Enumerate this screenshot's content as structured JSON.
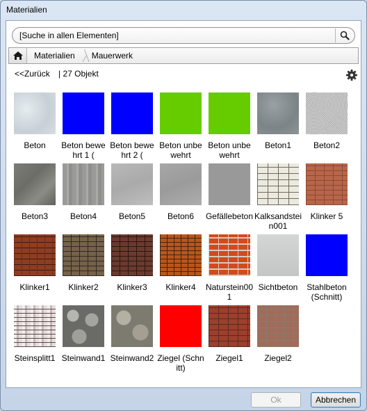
{
  "window": {
    "title": "Materialien"
  },
  "search": {
    "value": "[Suche in allen Elementen]",
    "icon": "search-icon"
  },
  "breadcrumb": {
    "home_icon": "home-icon",
    "items": [
      "Materialien",
      "Mauerwerk"
    ]
  },
  "nav": {
    "back_label": "<<Zurück",
    "count_label": "| 27 Objekt",
    "settings_icon": "gear-icon"
  },
  "materials": [
    {
      "name": "Beton",
      "texture": "concrete-light"
    },
    {
      "name": "Beton bewehrt 1 (",
      "texture": "blue",
      "color": "#0000ff"
    },
    {
      "name": "Beton bewehrt 2 (",
      "texture": "blue",
      "color": "#0000ff"
    },
    {
      "name": "Beton unbewehrt",
      "texture": "green",
      "color": "#66cc00"
    },
    {
      "name": "Beton unbewehrt",
      "texture": "green",
      "color": "#66cc00"
    },
    {
      "name": "Beton1",
      "texture": "concrete-dark"
    },
    {
      "name": "Beton2",
      "texture": "granite"
    },
    {
      "name": "Beton3",
      "texture": "slate"
    },
    {
      "name": "Beton4",
      "texture": "board"
    },
    {
      "name": "Beton5",
      "texture": "smooth"
    },
    {
      "name": "Beton6",
      "texture": "smooth2"
    },
    {
      "name": "Gefällebeton",
      "texture": "grey",
      "color": "#999999"
    },
    {
      "name": "Kalksandstein001",
      "texture": "calc"
    },
    {
      "name": "Klinker 5",
      "texture": "redbrick"
    },
    {
      "name": "Klinker1",
      "texture": "brick-strip"
    },
    {
      "name": "Klinker2",
      "texture": "brick-mixed"
    },
    {
      "name": "Klinker3",
      "texture": "brick-dark"
    },
    {
      "name": "Klinker4",
      "texture": "brick-orange"
    },
    {
      "name": "Naturstein001",
      "texture": "brick-bright"
    },
    {
      "name": "Sichtbeton",
      "texture": "sicht"
    },
    {
      "name": "Stahlbeton (Schnitt)",
      "texture": "blue",
      "color": "#0000ff"
    },
    {
      "name": "Steinsplitt1",
      "texture": "split"
    },
    {
      "name": "Steinwand1",
      "texture": "stone1"
    },
    {
      "name": "Steinwand2",
      "texture": "stone2"
    },
    {
      "name": "Ziegel (Schnitt)",
      "texture": "red",
      "color": "#ff0000"
    },
    {
      "name": "Ziegel1",
      "texture": "ziegel1"
    },
    {
      "name": "Ziegel2",
      "texture": "ziegel2"
    }
  ],
  "footer": {
    "ok_label": "Ok",
    "cancel_label": "Abbrechen"
  }
}
